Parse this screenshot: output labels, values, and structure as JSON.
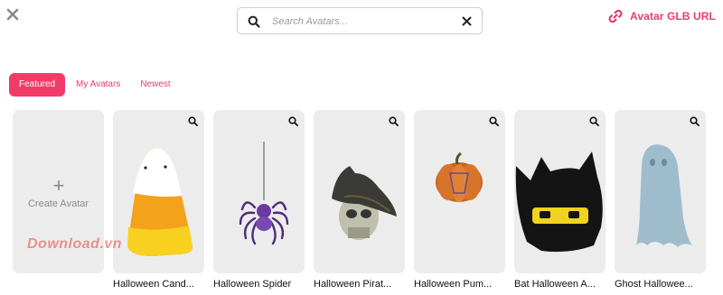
{
  "colors": {
    "accent": "#e83e6c",
    "card_bg": "#ececec",
    "active_tab_bg": "#f23c68"
  },
  "search": {
    "placeholder": "Search Avatars...",
    "value": ""
  },
  "header": {
    "glb_link_label": "Avatar GLB URL"
  },
  "tabs": [
    {
      "label": "Featured",
      "active": true
    },
    {
      "label": "My Avatars",
      "active": false
    },
    {
      "label": "Newest",
      "active": false
    }
  ],
  "create_card": {
    "label": "Create Avatar",
    "icon": "plus-icon"
  },
  "avatars": [
    {
      "name": "Halloween Cand...",
      "art": "candy-corn"
    },
    {
      "name": "Halloween Spider",
      "art": "spider"
    },
    {
      "name": "Halloween Pirat...",
      "art": "pirate-skull"
    },
    {
      "name": "Halloween Pum...",
      "art": "pumpkin"
    },
    {
      "name": "Bat Halloween A...",
      "art": "bat"
    },
    {
      "name": "Ghost Hallowee...",
      "art": "ghost"
    }
  ],
  "watermark": "Download.vn"
}
